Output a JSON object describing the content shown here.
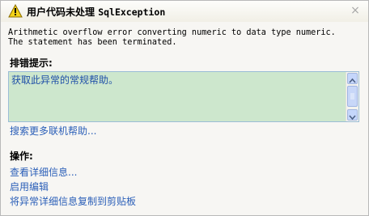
{
  "dialog": {
    "title_prefix": "用户代码未处理 ",
    "title_exception": "SqlException",
    "message_line1": "Arithmetic overflow error converting numeric to data type numeric.",
    "message_line2": "The statement has been terminated.",
    "troubleshooting_label": "排错提示:",
    "tip_text": "获取此异常的常规帮助。",
    "search_link": "搜索更多联机帮助...",
    "actions_label": "操作:",
    "actions": [
      "查看详细信息...",
      "启用编辑",
      "将异常详细信息复制到剪贴板"
    ],
    "close_glyph": "×"
  },
  "icons": {
    "warning": "warning-icon",
    "close": "close-icon",
    "scroll_up": "chevron-up-icon",
    "scroll_down": "chevron-down-icon"
  },
  "colors": {
    "tips_background": "#cde7cd",
    "link": "#2b5fb8"
  }
}
